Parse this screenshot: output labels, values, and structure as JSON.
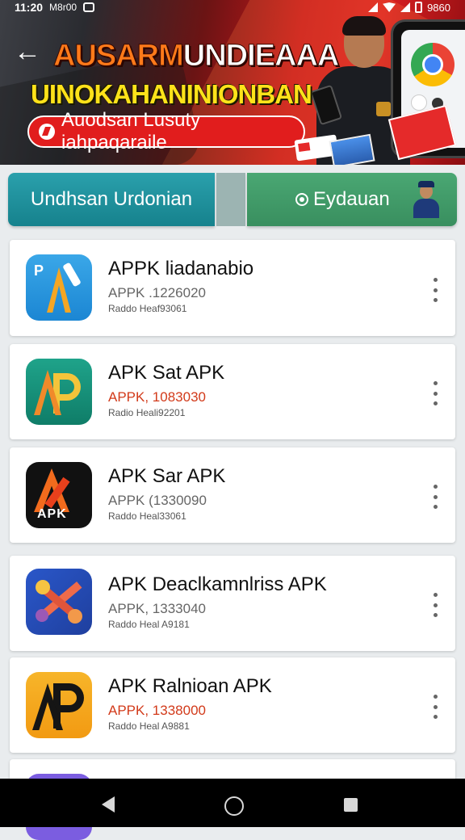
{
  "status_bar": {
    "time": "11:20",
    "carrier": "M8r00",
    "battery": "9860"
  },
  "banner": {
    "title_part1": "AUSARM",
    "title_part2": "UNDIEAAA",
    "subtitle": "UINOKAHANINIONBAN",
    "pill_text": "Auodsan Lusuty iahpaqaraile"
  },
  "actions": {
    "primary_label": "Undhsan Urdonian",
    "secondary_label": "Eydauan"
  },
  "apps": [
    {
      "name": "APPK liadanabio",
      "version": "APPK .1226020",
      "meta": "Raddo Heaf93061",
      "version_highlight": false
    },
    {
      "name": "APK Sat APK",
      "version": "APPK, 1083030",
      "meta": "Radio Heali92201",
      "version_highlight": true
    },
    {
      "name": "APK Sar APK",
      "version": "APPK (1330090",
      "meta": "Raddo Heal33061",
      "version_highlight": false
    },
    {
      "name": "APK Deaclkamnlriss APK",
      "version": "APPK, 1333040",
      "meta": "Raddo Heal A9181",
      "version_highlight": false
    },
    {
      "name": "APK Ralnioan APK",
      "version": "APPK, 1338000",
      "meta": "Raddo Heal A9881",
      "version_highlight": true
    }
  ],
  "icons": {
    "app_1": "apk-a-blue-icon",
    "app_2": "apk-ap-teal-icon",
    "app_3": "apk-black-icon",
    "app_4": "apk-cross-blue-icon",
    "app_5": "apk-ap-yellow-icon",
    "app_6": "purple-app-icon"
  },
  "colors": {
    "primary_button": "#1b8f9b",
    "secondary_button": "#43a06a",
    "version_highlight": "#d23a1a",
    "banner_red": "#d91f22"
  },
  "icon_text": {
    "app_1_letter": "P",
    "app_3_label": "APK"
  }
}
